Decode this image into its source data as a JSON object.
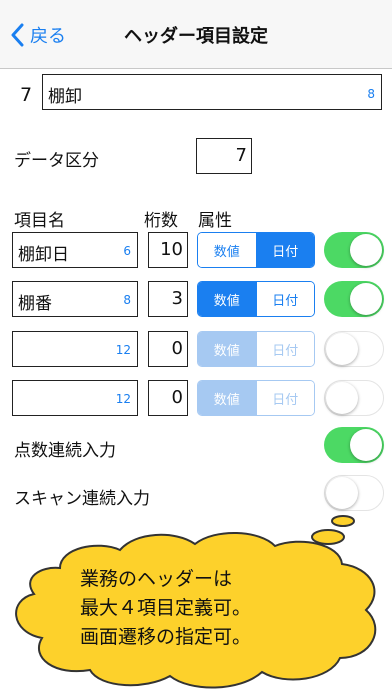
{
  "nav": {
    "back_label": "戻る",
    "title": "ヘッダー項目設定"
  },
  "header_row": {
    "number": "7",
    "value": "棚卸",
    "count": "8"
  },
  "data_category": {
    "label": "データ区分",
    "value": "7"
  },
  "columns": {
    "name": "項目名",
    "digits": "桁数",
    "attribute": "属性"
  },
  "segment_labels": {
    "numeric": "数値",
    "date": "日付"
  },
  "items": [
    {
      "name": "棚卸日",
      "count": "6",
      "digits": "10",
      "selected": "date",
      "enabled": true,
      "toggle": true
    },
    {
      "name": "棚番",
      "count": "8",
      "digits": "3",
      "selected": "numeric",
      "enabled": true,
      "toggle": true
    },
    {
      "name": "",
      "count": "12",
      "digits": "0",
      "selected": "numeric",
      "enabled": false,
      "toggle": false
    },
    {
      "name": "",
      "count": "12",
      "digits": "0",
      "selected": "numeric",
      "enabled": false,
      "toggle": false
    }
  ],
  "options": [
    {
      "label": "点数連続入力",
      "toggle": true
    },
    {
      "label": "スキャン連続入力",
      "toggle": false
    }
  ],
  "bubble": {
    "lines": [
      "業務のヘッダーは",
      "最大４項目定義可。",
      "画面遷移の指定可。"
    ],
    "fill": "#fdd12b"
  },
  "colors": {
    "accent": "#1a7ff0",
    "toggle_on": "#4cd964"
  }
}
